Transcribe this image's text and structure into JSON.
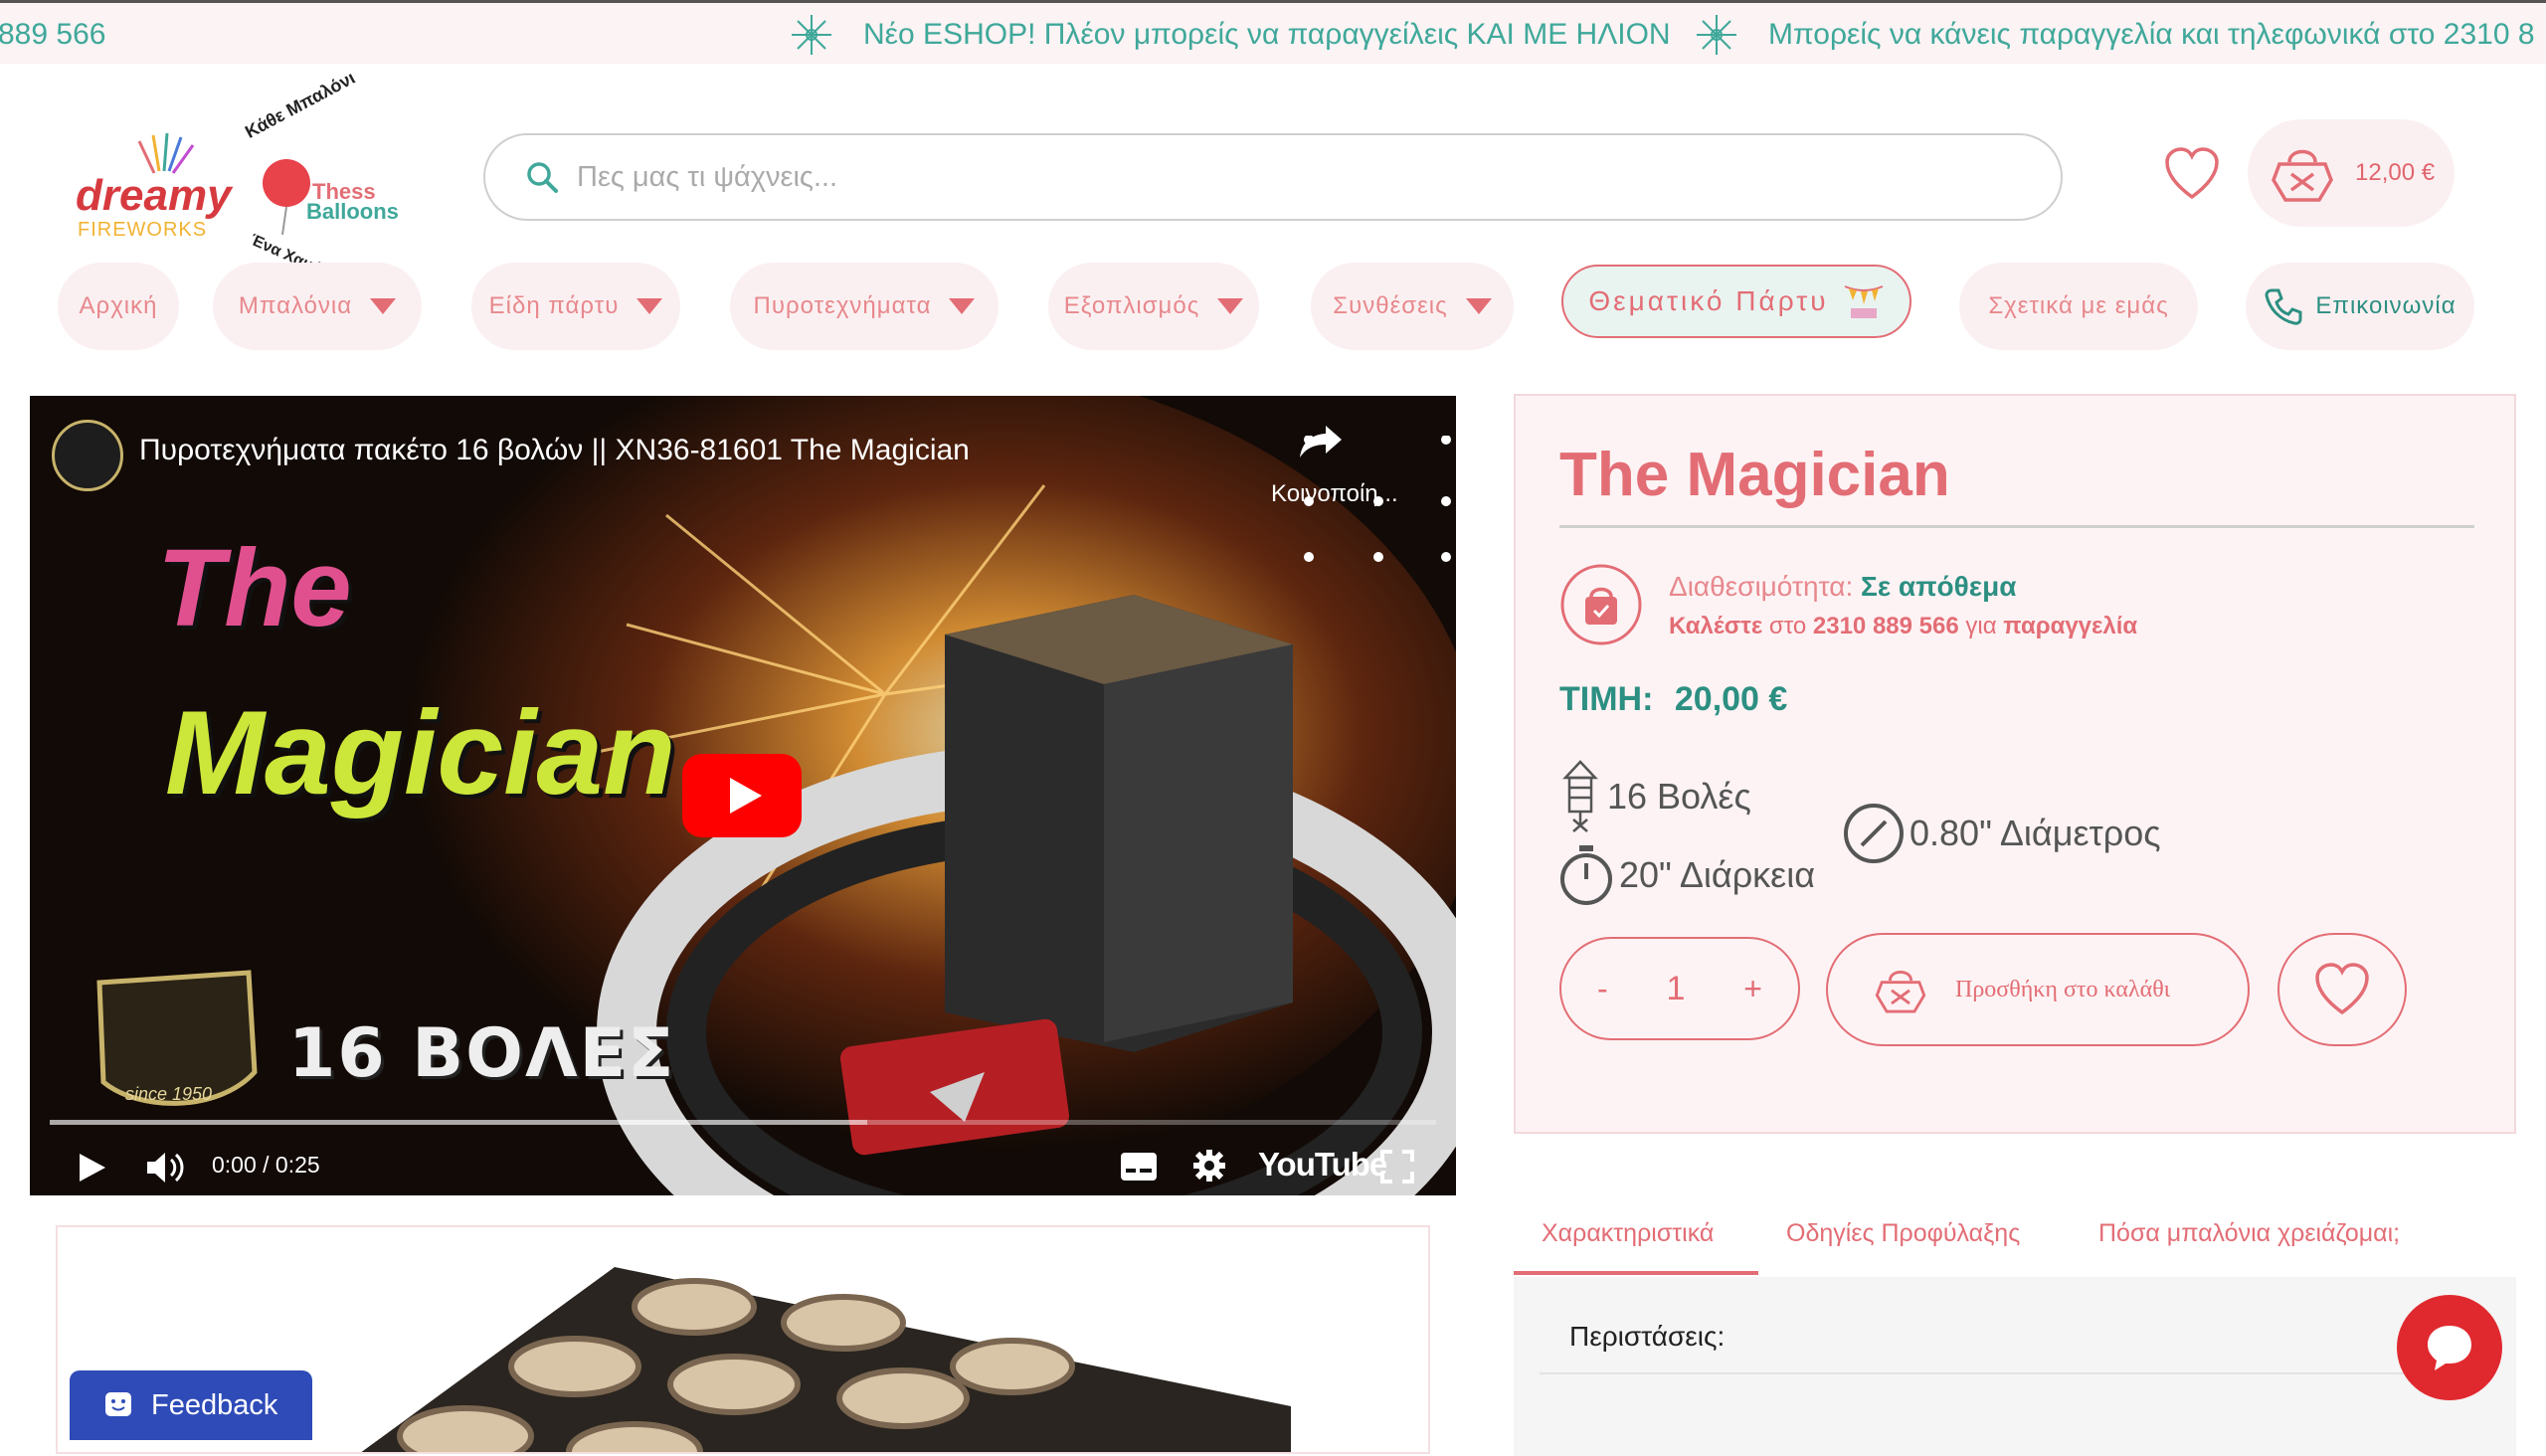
{
  "ticker": {
    "lead": "889 566",
    "items": [
      "Νέο ESHOP! Πλέον μπορείς να παραγγείλεις ΚΑΙ ΜΕ ΗΛΙΟΝ",
      "Μπορείς να κάνεις παραγγελία και τηλεφωνικά στο 2310 8"
    ]
  },
  "logo": {
    "brand_main": "dreamy",
    "brand_sub": "FIREWORKS",
    "balloon_top": "Κάθε Μπαλόνι",
    "balloon_name1": "Thess",
    "balloon_name2": "Balloons",
    "balloon_bottom": "Ένα Χαμόγελο"
  },
  "search": {
    "placeholder": "Πες μας τι ψάχνεις..."
  },
  "cart": {
    "total": "12,00 €"
  },
  "nav": {
    "home": "Αρχική",
    "balloons": "Μπαλόνια",
    "party": "Είδη πάρτυ",
    "fireworks": "Πυροτεχνήματα",
    "equipment": "Εξοπλισμός",
    "compositions": "Συνθέσεις",
    "theme_party": "Θεματικό Πάρτυ",
    "about": "Σχετικά με εμάς",
    "contact": "Επικοινωνία"
  },
  "video": {
    "title": "Πυροτεχνήματα πακέτο 16 βολών || XN36-81601 The Magician",
    "share": "Κοινοποίη...",
    "overlay_title_1": "The",
    "overlay_title_2": "Magician",
    "shots_label": "16 ΒΟΛΕΣ",
    "since": "since 1950",
    "time": "0:00 / 0:25",
    "youtube": "YouTube",
    "progress": 0.0,
    "buffered": 0.59
  },
  "product": {
    "title": "The Magician",
    "availability_label": "Διαθεσιμότητα:",
    "availability_value": "Σε απόθεμα",
    "call_1": "Καλέστε",
    "call_2": "στο",
    "call_phone": "2310 889 566",
    "call_3": "για",
    "call_4": "παραγγελία",
    "price_label": "ΤΙΜΗ:",
    "price_value": "20,00 €",
    "shots": "16 Βολές",
    "diameter": "0.80\" Διάμετρος",
    "duration": "20\" Διάρκεια",
    "qty_minus": "-",
    "qty_value": "1",
    "qty_plus": "+",
    "add_to_cart": "Προσθήκη στο καλάθι"
  },
  "tabs": {
    "items": [
      "Χαρακτηριστικά",
      "Οδηγίες Προφύλαξης",
      "Πόσα μπαλόνια χρειάζομαι;"
    ],
    "active": 0,
    "panel_heading": "Περιστάσεις:"
  },
  "feedback": {
    "label": "Feedback"
  },
  "colors": {
    "accent": "#e36d75",
    "teal": "#2c8f82",
    "pink_bg": "#fbf0f1"
  }
}
